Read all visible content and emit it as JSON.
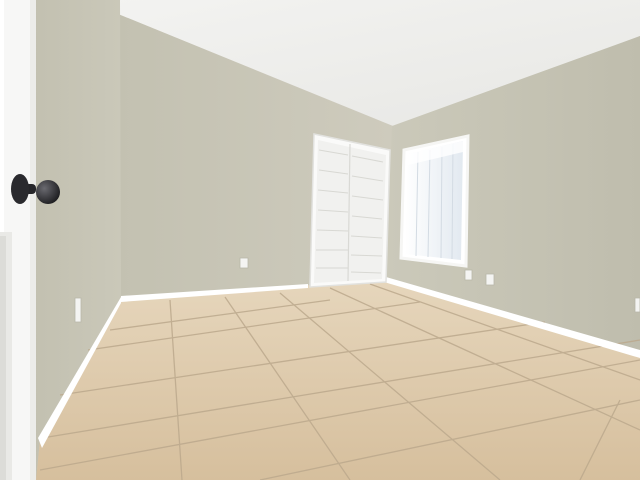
{
  "scene": {
    "subject": "empty-room",
    "colors": {
      "ceiling": "#f2f2f0",
      "wall_left_far": "#c8c6b6",
      "wall_back": "#c9c7b8",
      "wall_right": "#c6c4b4",
      "floor_tile": "#dcc7a8",
      "grout": "#b9a68a",
      "baseboard": "#ffffff",
      "door": "#f7f7f6",
      "closet_door": "#f4f4f2",
      "window_glass": "#eef3f8",
      "doorknob": "#2b2b2d"
    }
  },
  "watermark": {
    "text": ""
  }
}
